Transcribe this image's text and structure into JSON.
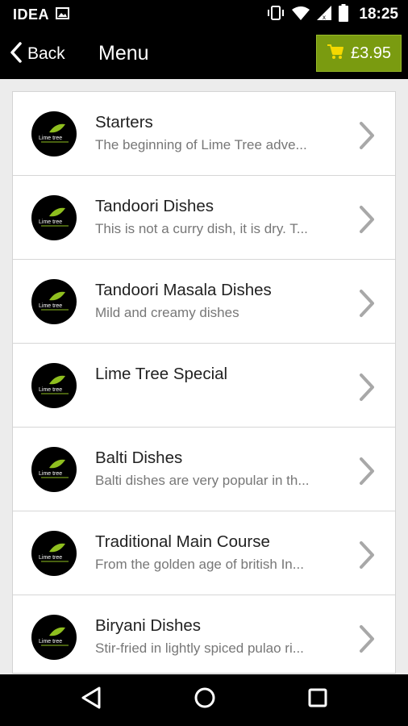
{
  "status_bar": {
    "carrier": "IDEA",
    "time": "18:25"
  },
  "app_bar": {
    "back_label": "Back",
    "title": "Menu",
    "cart_total": "£3.95"
  },
  "colors": {
    "cart_green": "#7a9b10",
    "logo_green": "#8fbf1f"
  },
  "menu": [
    {
      "title": "Starters",
      "description": "The beginning of Lime Tree adve..."
    },
    {
      "title": "Tandoori Dishes",
      "description": "This is not a curry dish, it is dry. T..."
    },
    {
      "title": "Tandoori Masala Dishes",
      "description": "Mild and creamy dishes"
    },
    {
      "title": "Lime Tree Special",
      "description": ""
    },
    {
      "title": "Balti Dishes",
      "description": "Balti dishes are very popular in th..."
    },
    {
      "title": "Traditional Main Course",
      "description": "From the golden age of british In..."
    },
    {
      "title": "Biryani Dishes",
      "description": "Stir-fried in lightly spiced pulao ri..."
    }
  ],
  "icons": {
    "back": "chevron-left-icon",
    "cart": "cart-icon",
    "row_arrow": "chevron-right-icon",
    "nav": [
      "back-triangle-icon",
      "home-circle-icon",
      "recents-square-icon"
    ]
  }
}
